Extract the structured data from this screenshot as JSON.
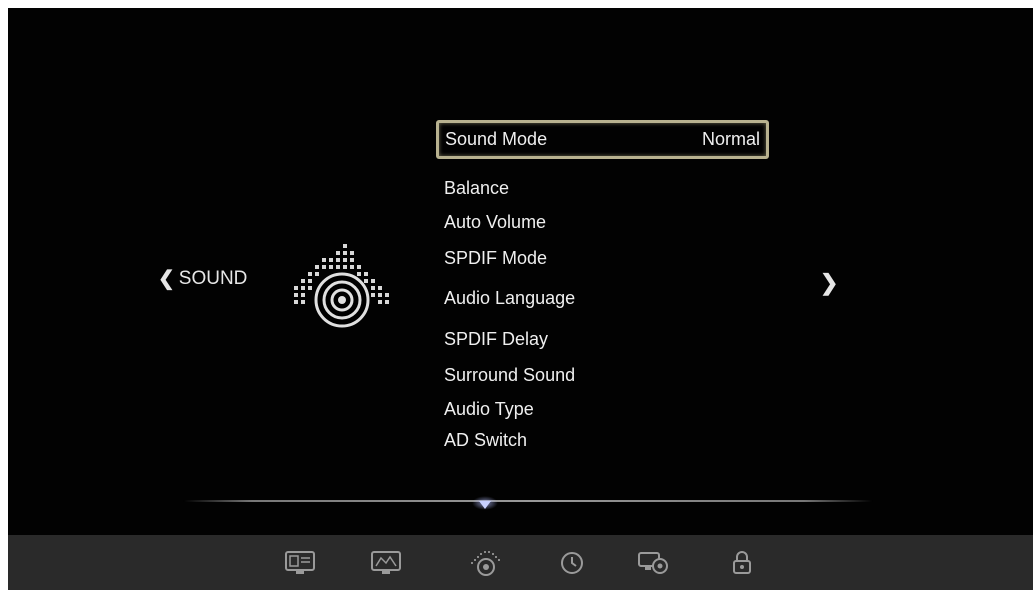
{
  "category": {
    "label": "SOUND",
    "prev_icon": "chevron-left-icon",
    "next_icon": "chevron-right-icon",
    "icon": "speaker-equalizer-icon"
  },
  "menu": {
    "items": [
      {
        "label": "Sound Mode",
        "value": "Normal",
        "selected": true
      },
      {
        "label": "Balance"
      },
      {
        "label": "Auto Volume"
      },
      {
        "label": "SPDIF Mode"
      },
      {
        "label": "Audio Language"
      },
      {
        "label": "SPDIF Delay"
      },
      {
        "label": "Surround Sound"
      },
      {
        "label": "Audio Type"
      },
      {
        "label": "AD Switch"
      }
    ]
  },
  "tabs": [
    {
      "icon": "picture-monitor-icon"
    },
    {
      "icon": "screen-monitor-icon"
    },
    {
      "icon": "sound-speaker-icon",
      "active": true
    },
    {
      "icon": "clock-icon"
    },
    {
      "icon": "settings-gear-icon"
    },
    {
      "icon": "lock-icon"
    }
  ],
  "colors": {
    "background": "#000000",
    "text": "#efefef",
    "selection_border": "#b8b290",
    "tabbar": "#2a2a2a"
  }
}
